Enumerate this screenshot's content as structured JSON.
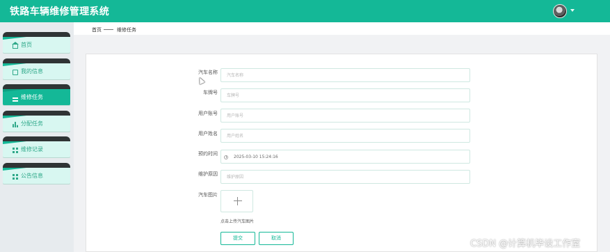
{
  "app": {
    "title": "铁路车辆维修管理系统"
  },
  "header": {
    "avatar_icon": "user-avatar",
    "caret_icon": "caret-down-icon"
  },
  "sidebar": {
    "items": [
      {
        "label": "首页",
        "icon": "home-icon"
      },
      {
        "label": "我的信息",
        "icon": "id-card-icon"
      },
      {
        "label": "维修任务",
        "icon": "list-icon",
        "active": true
      },
      {
        "label": "分配任务",
        "icon": "bar-chart-icon"
      },
      {
        "label": "维修记录",
        "icon": "grid-icon"
      },
      {
        "label": "公告信息",
        "icon": "grid-icon"
      }
    ]
  },
  "breadcrumb": {
    "home": "首页",
    "current": "维修任务"
  },
  "form": {
    "car_name": {
      "label": "汽车名称",
      "placeholder": "汽车名称",
      "value": ""
    },
    "car_number": {
      "label": "车牌号",
      "placeholder": "车牌号",
      "value": ""
    },
    "user_account": {
      "label": "用户账号",
      "placeholder": "用户账号",
      "value": ""
    },
    "user_name": {
      "label": "用户姓名",
      "placeholder": "用户姓名",
      "value": ""
    },
    "appointment_time": {
      "label": "预约时间",
      "value": "2025-03-10 15:24:16"
    },
    "repair_reason": {
      "label": "维护原因",
      "placeholder": "维护原因",
      "value": ""
    },
    "car_image": {
      "label": "汽车图片",
      "hint": "点击上传汽车图片"
    },
    "submit_label": "提交",
    "cancel_label": "取消"
  },
  "watermark": "CSDN @计算机毕设工作室",
  "colors": {
    "primary": "#14b897",
    "sidebar_bg": "#e7ebee",
    "nav_item_bg": "#d8f7f1",
    "nav_item_top": "#2f3435"
  }
}
